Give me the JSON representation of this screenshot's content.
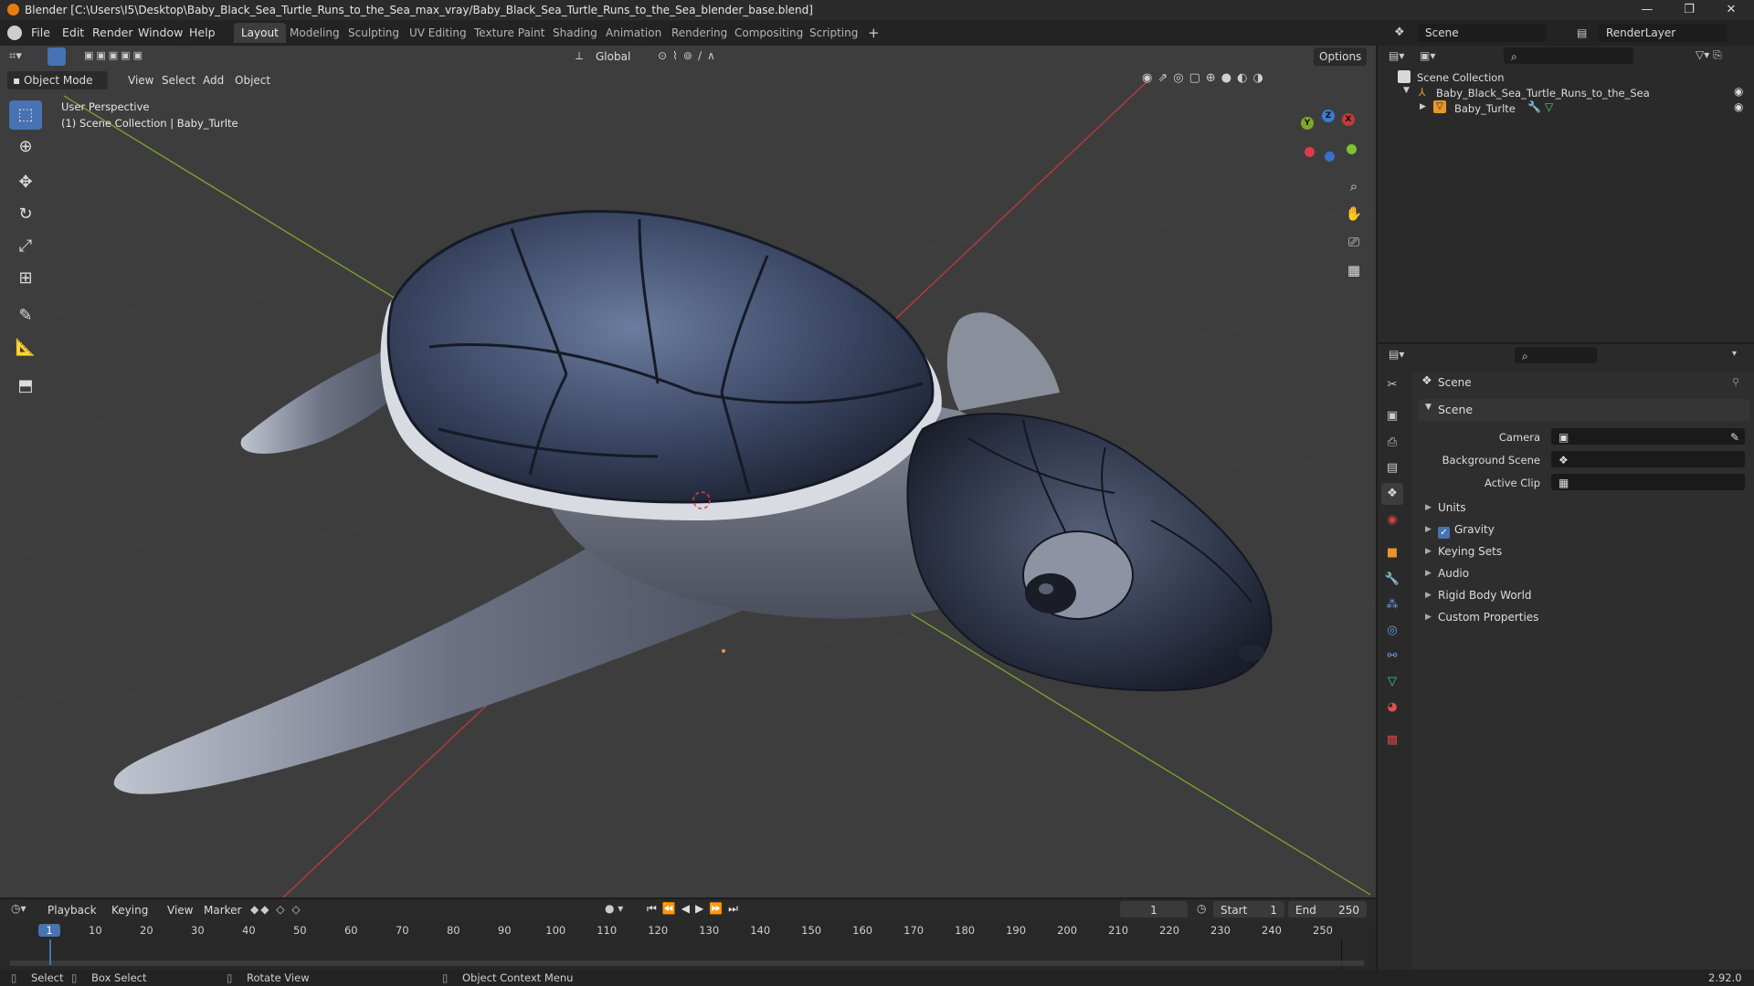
{
  "window": {
    "title": "Blender [C:\\Users\\I5\\Desktop\\Baby_Black_Sea_Turtle_Runs_to_the_Sea_max_vray/Baby_Black_Sea_Turtle_Runs_to_the_Sea_blender_base.blend]",
    "minimize": "—",
    "maximize": "❐",
    "close": "✕"
  },
  "menus": [
    "File",
    "Edit",
    "Render",
    "Window",
    "Help"
  ],
  "workspace_tabs": [
    "Layout",
    "Modeling",
    "Sculpting",
    "UV Editing",
    "Texture Paint",
    "Shading",
    "Animation",
    "Rendering",
    "Compositing",
    "Scripting"
  ],
  "active_workspace": "Layout",
  "add_tab": "+",
  "scene_field": "Scene",
  "renderlayer_field": "RenderLayer",
  "viewport": {
    "transform_orientation": "Global",
    "options_label": "Options",
    "mode": "Object Mode",
    "header_menus": [
      "View",
      "Select",
      "Add",
      "Object"
    ],
    "perspective": "User Perspective",
    "collection_info": "(1) Scene Collection | Baby_Turlte",
    "gizmo": {
      "x": "X",
      "y": "Y",
      "z": "Z"
    }
  },
  "outliner": {
    "root": "Scene Collection",
    "collection": "Baby_Black_Sea_Turtle_Runs_to_the_Sea",
    "object": "Baby_Turlte"
  },
  "properties": {
    "context": "Scene",
    "panel": "Scene",
    "fields": [
      {
        "label": "Camera",
        "value": ""
      },
      {
        "label": "Background Scene",
        "value": ""
      },
      {
        "label": "Active Clip",
        "value": ""
      }
    ],
    "sections": [
      "Units",
      "Gravity",
      "Keying Sets",
      "Audio",
      "Rigid Body World",
      "Custom Properties"
    ],
    "gravity_checked": true
  },
  "timeline": {
    "menus": [
      "Playback",
      "Keying",
      "View",
      "Marker"
    ],
    "current_frame": "1",
    "start_label": "Start",
    "start_value": "1",
    "end_label": "End",
    "end_value": "250",
    "ticks": [
      "1",
      "10",
      "20",
      "30",
      "40",
      "50",
      "60",
      "70",
      "80",
      "90",
      "100",
      "110",
      "120",
      "130",
      "140",
      "150",
      "160",
      "170",
      "180",
      "190",
      "200",
      "210",
      "220",
      "230",
      "240",
      "250"
    ]
  },
  "statusbar": {
    "select": "Select",
    "box_select": "Box Select",
    "rotate_view": "Rotate View",
    "context_menu": "Object Context Menu",
    "version": "2.92.0"
  },
  "colors": {
    "accent": "#4772b3",
    "x_axis": "#c33a3a",
    "y_axis": "#7da82a",
    "z_axis": "#3b7bd4",
    "viewport_bg": "#3d3d3d"
  }
}
